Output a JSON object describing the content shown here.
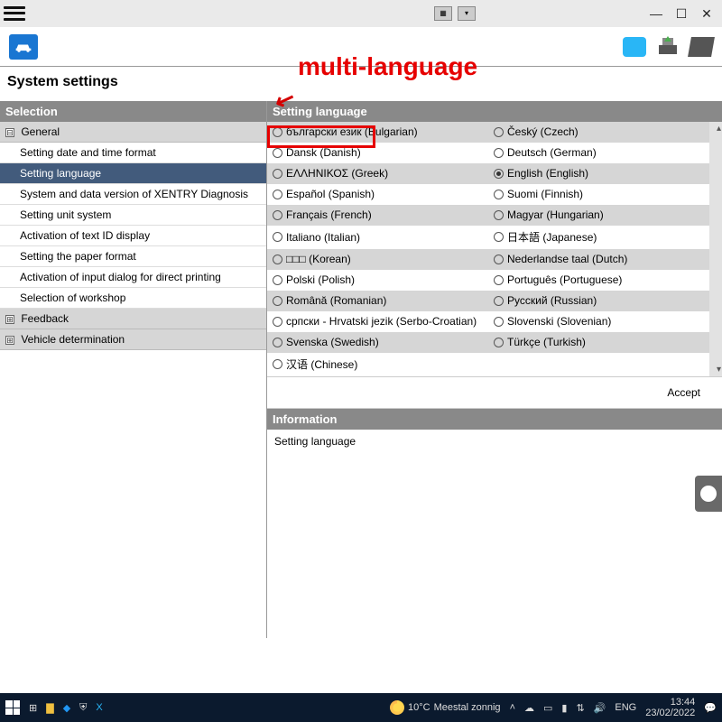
{
  "annotation": {
    "title": "multi-language",
    "arrow": "↙"
  },
  "page": {
    "title": "System settings"
  },
  "sidebar": {
    "header": "Selection",
    "groups": [
      {
        "label": "General",
        "expander": "⊟"
      },
      {
        "label": "Feedback",
        "expander": "⊞"
      },
      {
        "label": "Vehicle determination",
        "expander": "⊞"
      }
    ],
    "items": [
      "Setting date and time format",
      "Setting language",
      "System and data version of XENTRY Diagnosis",
      "Setting unit system",
      "Activation of text ID display",
      "Setting the paper format",
      "Activation of input dialog for direct printing",
      "Selection of workshop"
    ]
  },
  "langpanel": {
    "header": "Setting language",
    "accept": "Accept",
    "rows": [
      {
        "l": "български език (Bulgarian)",
        "r": "Český (Czech)"
      },
      {
        "l": "Dansk (Danish)",
        "r": "Deutsch (German)"
      },
      {
        "l": "ΕΛΛΗΝΙΚΟΣ (Greek)",
        "r": "English (English)",
        "sel_r": true
      },
      {
        "l": "Español (Spanish)",
        "r": "Suomi (Finnish)"
      },
      {
        "l": "Français (French)",
        "r": "Magyar (Hungarian)"
      },
      {
        "l": "Italiano (Italian)",
        "r": "日本語 (Japanese)"
      },
      {
        "l": "□□□ (Korean)",
        "r": "Nederlandse taal (Dutch)"
      },
      {
        "l": "Polski (Polish)",
        "r": "Português (Portuguese)"
      },
      {
        "l": "Română (Romanian)",
        "r": "Русский (Russian)"
      },
      {
        "l": "српски - Hrvatski jezik (Serbo-Croatian)",
        "r": "Slovenski (Slovenian)"
      },
      {
        "l": "Svenska (Swedish)",
        "r": "Türkçe (Turkish)"
      },
      {
        "l": "汉语 (Chinese)",
        "r": ""
      }
    ]
  },
  "info": {
    "header": "Information",
    "body": "Setting language"
  },
  "taskbar": {
    "weather_temp": "10°C",
    "weather_text": "Meestal zonnig",
    "lang": "ENG",
    "time": "13:44",
    "date": "23/02/2022"
  }
}
